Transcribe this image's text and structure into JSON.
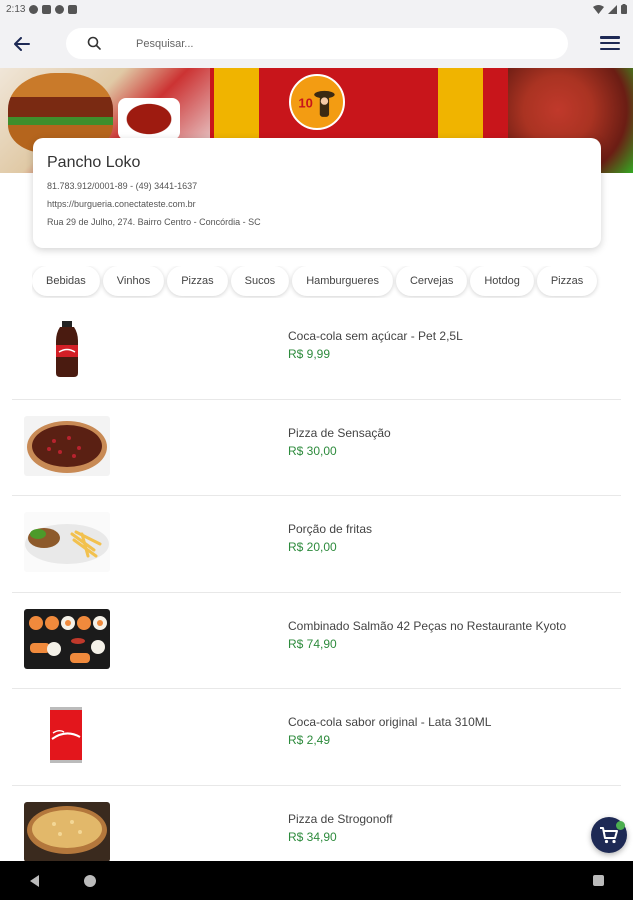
{
  "status_bar": {
    "time": "2:13"
  },
  "header": {
    "search_placeholder": "Pesquisar...",
    "icons": [
      "back-arrow-icon",
      "search-icon",
      "menu-icon"
    ]
  },
  "banner": {
    "logo_text": "10"
  },
  "store": {
    "name": "Pancho Loko",
    "document_phone": "81.783.912/0001-89 - (49) 3441-1637",
    "website": "https://burgueria.conectateste.com.br",
    "address": "Rua 29 de Julho, 274. Bairro Centro - Concórdia - SC"
  },
  "categories": [
    "Bebidas",
    "Vinhos",
    "Pizzas",
    "Sucos",
    "Hamburgueres",
    "Cervejas",
    "Hotdog",
    "Pizzas"
  ],
  "products": [
    {
      "name": "Coca-cola sem açúcar - Pet 2,5L",
      "price": "R$ 9,99",
      "image": "coke-bottle"
    },
    {
      "name": "Pizza de Sensação",
      "price": "R$ 30,00",
      "image": "chocolate-pizza"
    },
    {
      "name": "Porção de fritas",
      "price": "R$ 20,00",
      "image": "fries-platter"
    },
    {
      "name": "Combinado Salmão 42 Peças no Restaurante Kyoto",
      "price": "R$ 74,90",
      "image": "sushi-combo"
    },
    {
      "name": "Coca-cola sabor original - Lata 310ML",
      "price": "R$ 2,49",
      "image": "coke-can"
    },
    {
      "name": "Pizza de Strogonoff",
      "price": "R$ 34,90",
      "image": "strogonoff-pizza"
    }
  ],
  "colors": {
    "accent": "#1e2a55",
    "price": "#2e8b3d",
    "banner_red": "#c8151b",
    "banner_yellow": "#f0b400"
  }
}
